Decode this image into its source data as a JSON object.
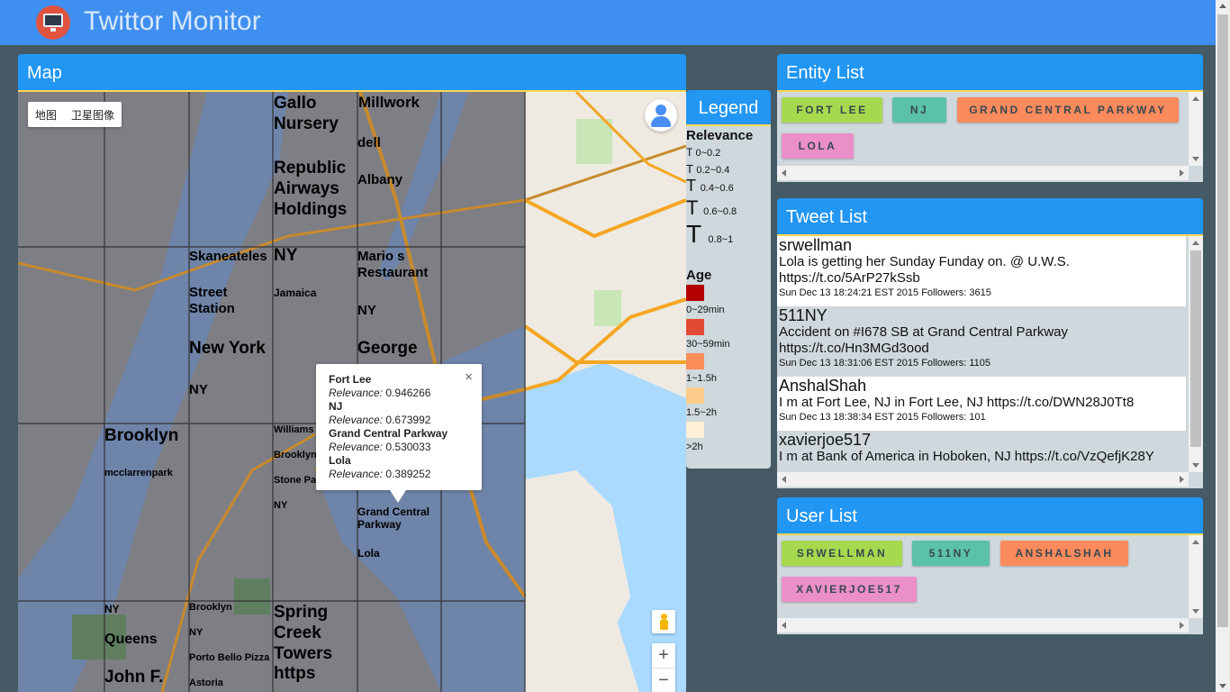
{
  "app": {
    "title": "Twittor Monitor",
    "logo_icon": "monitor-icon",
    "logo_color": "#e0533f",
    "accent": "#2196f3"
  },
  "map": {
    "panel_title": "Map",
    "maptype": {
      "map_label": "地图",
      "satellite_label": "卫星图像"
    },
    "labels": [
      {
        "text": "Gallo Nursery",
        "color": "#a50f15",
        "size": "l"
      },
      {
        "text": "Millwork",
        "color": "#e55a3c",
        "size": "l"
      },
      {
        "text": "dell",
        "color": "#de2d26",
        "size": "m"
      },
      {
        "text": "Republic Airways Holdings",
        "color": "#fff5eb",
        "size": "l"
      },
      {
        "text": "Albany",
        "color": "#de2d26",
        "size": "m"
      },
      {
        "text": "Skaneateles",
        "color": "#fff5eb",
        "size": "m"
      },
      {
        "text": "NY",
        "color": "#fff5eb",
        "size": "l"
      },
      {
        "text": "Mario s Restaurant",
        "color": "#fdc77d",
        "size": "m"
      },
      {
        "text": "Street Station",
        "color": "#fc8d59",
        "size": "m"
      },
      {
        "text": "Jamaica",
        "color": "#cb181d",
        "size": "s"
      },
      {
        "text": "NY",
        "color": "#fc8d59",
        "size": "m"
      },
      {
        "text": "New York",
        "color": "#a50f15",
        "size": "l"
      },
      {
        "text": "George",
        "color": "#fff5eb",
        "size": "l"
      },
      {
        "text": "NY",
        "color": "#e55a3c",
        "size": "m"
      },
      {
        "text": "Brooklyn",
        "color": "#fc8d59",
        "size": "l"
      },
      {
        "text": "Williams",
        "color": "#fdc77d",
        "size": "s"
      },
      {
        "text": "mcclarrenpark",
        "color": "#de2d26",
        "size": "s"
      },
      {
        "text": "Brooklyn",
        "color": "#cb181d",
        "size": "s"
      },
      {
        "text": "Stone Pa",
        "color": "#cb181d",
        "size": "s"
      },
      {
        "text": "NY",
        "color": "#de2d26",
        "size": "s"
      },
      {
        "text": "Grand Central Parkway",
        "color": "#e55a3c",
        "size": "s"
      },
      {
        "text": "Lola",
        "color": "#cb181d",
        "size": "s"
      },
      {
        "text": "NY",
        "color": "#fdc77d",
        "size": "s"
      },
      {
        "text": "Brooklyn",
        "color": "#fdc77d",
        "size": "s"
      },
      {
        "text": "Spring Creek Towers https",
        "color": "#a50f15",
        "size": "l"
      },
      {
        "text": "Queens",
        "color": "#e55a3c",
        "size": "m"
      },
      {
        "text": "NY",
        "color": "#de2d26",
        "size": "s"
      },
      {
        "text": "Porto Bello Pizza",
        "color": "#e55a3c",
        "size": "s"
      },
      {
        "text": "John F.",
        "color": "#a50f15",
        "size": "l"
      },
      {
        "text": "Astoria",
        "color": "#fdc77d",
        "size": "s"
      }
    ],
    "info_window": {
      "items": [
        {
          "name": "Fort Lee",
          "relevance_label": "Relevance:",
          "relevance": "0.946266"
        },
        {
          "name": "NJ",
          "relevance_label": "Relevance:",
          "relevance": "0.673992"
        },
        {
          "name": "Grand Central Parkway",
          "relevance_label": "Relevance:",
          "relevance": "0.530033"
        },
        {
          "name": "Lola",
          "relevance_label": "Relevance:",
          "relevance": "0.389252"
        }
      ],
      "close_glyph": "×"
    },
    "zoom": {
      "in": "+",
      "out": "−"
    }
  },
  "legend": {
    "title": "Legend",
    "relevance_title": "Relevance",
    "relevance_items": [
      {
        "glyph": "T",
        "range": "0~0.2"
      },
      {
        "glyph": "T",
        "range": "0.2~0.4"
      },
      {
        "glyph": "T",
        "range": "0.4~0.6"
      },
      {
        "glyph": "T",
        "range": "0.6~0.8"
      },
      {
        "glyph": "T",
        "range": "0.8~1"
      }
    ],
    "age_title": "Age",
    "age_items": [
      {
        "color": "#b30000",
        "label": "0~29min"
      },
      {
        "color": "#e34a33",
        "label": "30~59min"
      },
      {
        "color": "#fc8d59",
        "label": "1~1.5h"
      },
      {
        "color": "#fdcc8a",
        "label": "1.5~2h"
      },
      {
        "color": "#fef0d9",
        "label": ">2h"
      }
    ]
  },
  "entity_list": {
    "title": "Entity List",
    "chips": [
      {
        "label": "FORT LEE",
        "color": "#a6d94e"
      },
      {
        "label": "NJ",
        "color": "#5bc2a7"
      },
      {
        "label": "GRAND CENTRAL PARKWAY",
        "color": "#fb8a5c"
      },
      {
        "label": "LOLA",
        "color": "#ea8fc8"
      }
    ]
  },
  "tweet_list": {
    "title": "Tweet List",
    "tweets": [
      {
        "user": "srwellman",
        "text": "Lola is getting her Sunday Funday on. @ U.W.S. https://t.co/5ArP27kSsb",
        "meta": "Sun Dec 13 18:24:21 EST 2015 Followers: 3615",
        "bg": "#ffffff"
      },
      {
        "user": "511NY",
        "text": "Accident on #I678 SB at Grand Central Parkway https://t.co/Hn3MGd3ood",
        "meta": "Sun Dec 13 18:31:06 EST 2015 Followers: 1105",
        "bg": "#cfd8dc"
      },
      {
        "user": "AnshalShah",
        "text": "I m at Fort Lee, NJ in Fort Lee, NJ https://t.co/DWN28J0Tt8",
        "meta": "Sun Dec 13 18:38:34 EST 2015 Followers: 101",
        "bg": "#ffffff"
      },
      {
        "user": "xavierjoe517",
        "text": "I m at Bank of America in Hoboken, NJ https://t.co/VzQefjK28Y",
        "meta": "",
        "bg": "#cfd8dc"
      }
    ]
  },
  "user_list": {
    "title": "User List",
    "chips": [
      {
        "label": "SRWELLMAN",
        "color": "#a6d94e"
      },
      {
        "label": "511NY",
        "color": "#5bc2a7"
      },
      {
        "label": "ANSHALSHAH",
        "color": "#fb8a5c"
      },
      {
        "label": "XAVIERJOE517",
        "color": "#ea8fc8"
      }
    ]
  }
}
